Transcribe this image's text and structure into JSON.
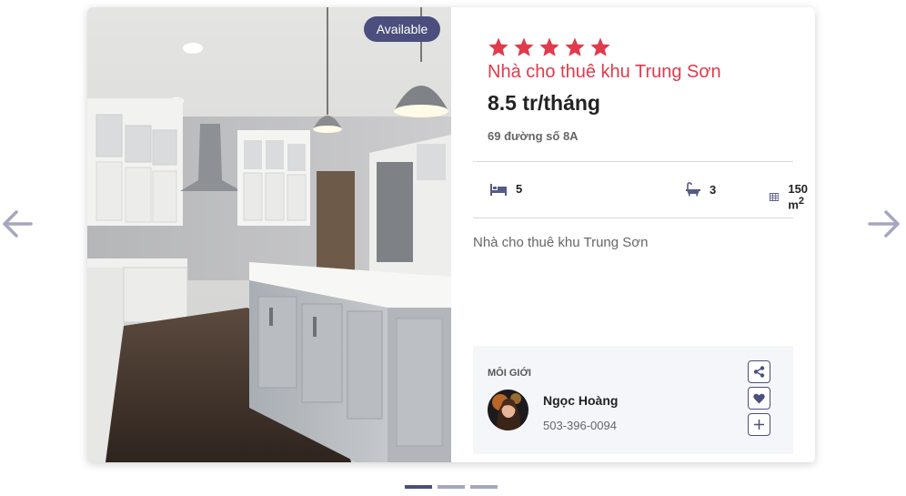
{
  "icons": {
    "prev": "arrow-left-icon",
    "next": "arrow-right-icon",
    "star": "star-icon",
    "bed": "bed-icon",
    "bath": "bathtub-icon",
    "area": "grid-area-icon",
    "share": "share-icon",
    "favorite": "heart-icon",
    "add": "plus-icon"
  },
  "colors": {
    "accent": "#e23a4c",
    "brand": "#4c4e7e",
    "arrow": "#a6a6c0",
    "agent_bg": "#f4f6f9"
  },
  "listing": {
    "badge": "Available",
    "rating": 5,
    "title": "Nhà cho thuê khu Trung Sơn",
    "price": "8.5 tr/tháng",
    "address": "69 đường số 8A",
    "features": {
      "beds": "5",
      "baths": "3",
      "area": "150 m",
      "area_unit_sup": "2"
    },
    "description": "Nhà cho thuê khu Trung Sơn"
  },
  "agent": {
    "label": "MÔI GIỚI",
    "name": "Ngọc Hoàng",
    "phone": "503-396-0094"
  },
  "carousel": {
    "slides": 3,
    "active_index": 0
  }
}
